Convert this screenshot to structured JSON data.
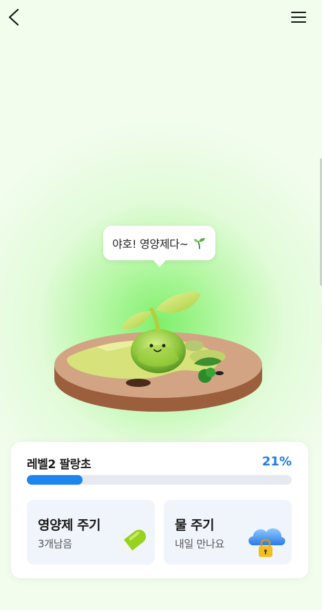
{
  "bubble": {
    "text": "야호! 영양제다~"
  },
  "level": {
    "title": "레벨2 팔랑초",
    "percent_label": "21%",
    "progress": 0.21
  },
  "actions": [
    {
      "title": "영양제 주기",
      "subtitle": "3개남음",
      "icon": "pill-icon"
    },
    {
      "title": "물 주기",
      "subtitle": "내일 만나요",
      "icon": "locked-cloud-icon"
    }
  ],
  "icons": {
    "back": "chevron-left-icon",
    "menu": "hamburger-menu-icon",
    "sprout": "sprout-icon"
  },
  "colors": {
    "accent": "#1f7be3",
    "progress_fill": "#1e85ee",
    "progress_track": "#e6e9f0",
    "action_bg": "#f0f5fb"
  }
}
